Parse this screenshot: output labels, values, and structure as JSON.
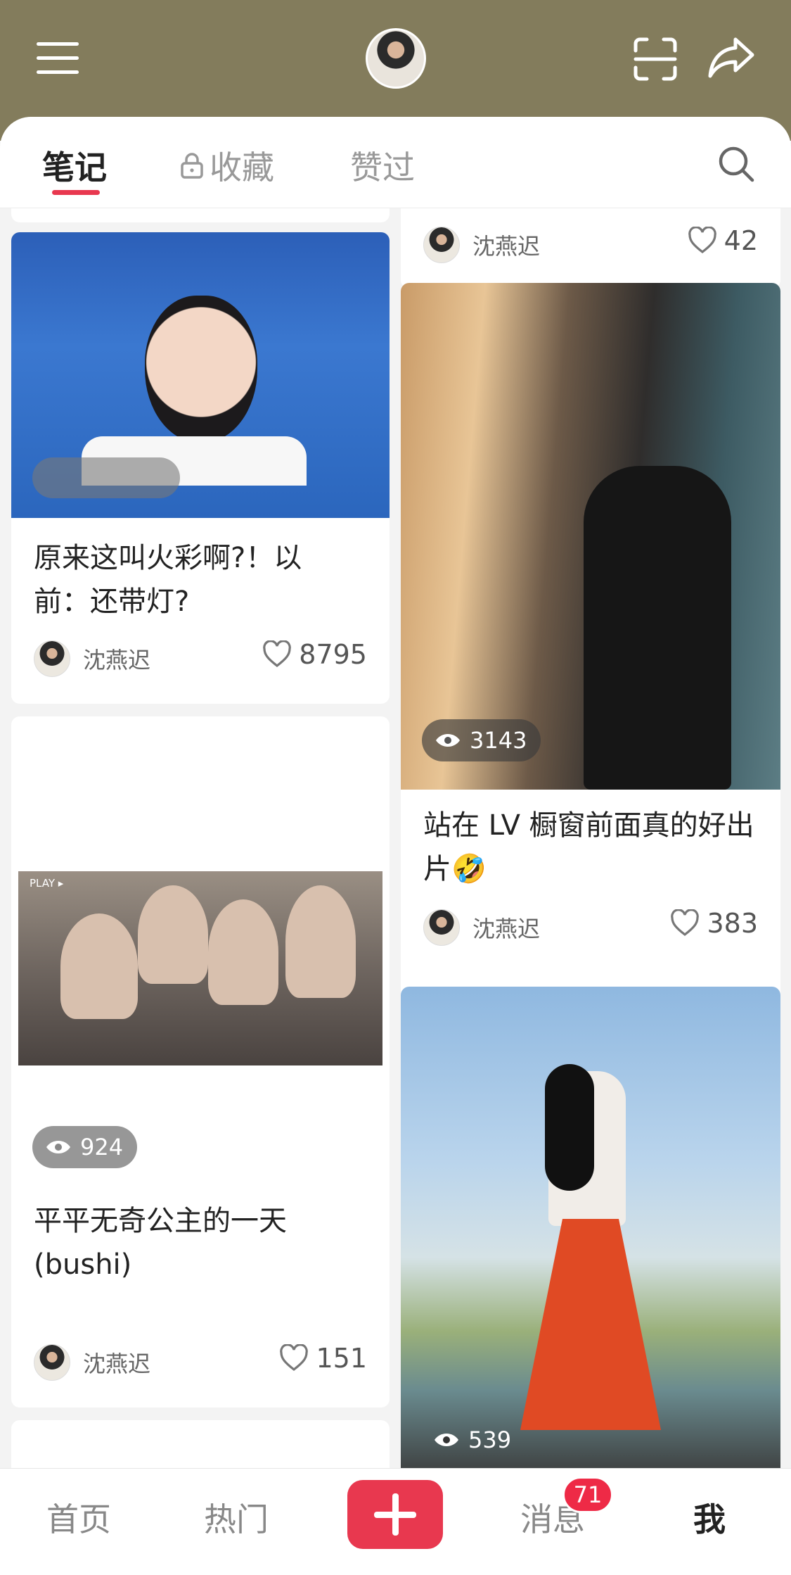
{
  "header": {
    "menu_icon": "menu-icon",
    "avatar_icon": "avatar",
    "scan_icon": "scan-icon",
    "share_icon": "share-icon",
    "background": "#837c5c"
  },
  "tabs": [
    {
      "label": "笔记",
      "active": true
    },
    {
      "label": "收藏",
      "icon": "lock-icon"
    },
    {
      "label": "赞过"
    }
  ],
  "accent": "#e8384f",
  "cards": [
    {
      "title": "",
      "author": "沈燕迟",
      "likes": "42"
    },
    {
      "title_line1": "原来这叫火彩啊?！以",
      "title_line2": "前：还带灯?",
      "author": "沈燕迟",
      "likes": "8795"
    },
    {
      "views": "3143",
      "title_line1": "站在 LV 橱窗前面真的好出",
      "title_line2": "片🤣",
      "author": "沈燕迟",
      "likes": "383"
    },
    {
      "play_label": "PLAY ▸",
      "views": "924",
      "title_line1": "平平无奇公主的一天",
      "title_line2": "(bushi)",
      "author": "沈燕迟",
      "likes": "151"
    },
    {
      "views": "539"
    }
  ],
  "bottom_nav": [
    {
      "label": "首页"
    },
    {
      "label": "热门"
    },
    {
      "label": "+",
      "icon": "plus-icon"
    },
    {
      "label": "消息",
      "badge": "71"
    },
    {
      "label": "我",
      "active": true
    }
  ]
}
